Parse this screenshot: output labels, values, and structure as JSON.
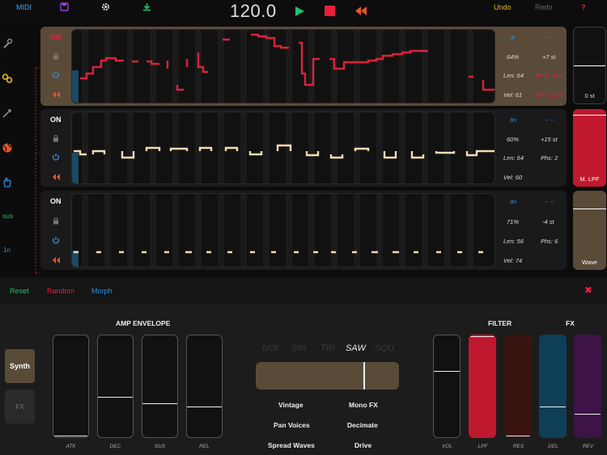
{
  "topbar": {
    "midi": "MIDI",
    "tempo": "120.0",
    "undo": "Undo",
    "redo": "Redo",
    "help": "?",
    "icons": [
      "save-icon",
      "gear-icon",
      "download-icon",
      "play-icon",
      "stop-icon",
      "rewind-icon"
    ]
  },
  "sidebar": {
    "sus_label": "sus",
    "oneN_label": "1n"
  },
  "rows": [
    {
      "on_label": "ON",
      "division": "4t",
      "percent": "64%",
      "transpose": "+7 st",
      "length": "Len: 64",
      "extra": "RPT: 30%",
      "velocity": "Vel: 61",
      "extra2": "RPT: 10%",
      "arrows": "→ ←"
    },
    {
      "on_label": "ON",
      "division": "8n",
      "percent": "60%",
      "transpose": "+15 st",
      "length": "Len: 64",
      "extra": "Phs: 2",
      "velocity": "Vel: 60",
      "arrows": "→ ←"
    },
    {
      "on_label": "ON",
      "division": "8n",
      "percent": "71%",
      "transpose": "-4 st",
      "length": "Len: 56",
      "extra": "Phs: 6",
      "velocity": "Vel: 74",
      "arrows": "→ ←"
    }
  ],
  "macros": [
    {
      "label": "0 st",
      "level": 0.5
    },
    {
      "label": "M. LPF",
      "level": 0.93
    },
    {
      "label": "Wave",
      "level": 0.78
    }
  ],
  "actions": {
    "reset": "Reset",
    "random": "Random",
    "morph": "Morph",
    "close": "✖"
  },
  "bottom": {
    "tab_synth": "Synth",
    "tab_fx": "FX",
    "amp_env": "AMP ENVELOPE",
    "filter": "FILTER",
    "fx": "FX",
    "env_sliders": [
      {
        "label": "ATK",
        "level": 0.0
      },
      {
        "label": "DEC",
        "level": 0.4
      },
      {
        "label": "SUS",
        "level": 0.33
      },
      {
        "label": "REL",
        "level": 0.3
      }
    ],
    "waves": [
      "NOI",
      "SIN",
      "TRI",
      "SAW",
      "SQU"
    ],
    "selected_wave": "SAW",
    "wave_mix": 0.75,
    "options": [
      "Vintage",
      "Mono FX",
      "Pan Voices",
      "Decimate",
      "Spread Waves",
      "Drive"
    ],
    "right_sliders": [
      {
        "label": "VOL",
        "level": 0.65,
        "color": "#111111"
      },
      {
        "label": "LPF",
        "level": 1.0,
        "color": "#c0182e"
      },
      {
        "label": "RES",
        "level": 0.0,
        "color": "#3a1410"
      },
      {
        "label": "DEL",
        "level": 0.3,
        "color": "#0f3e58"
      },
      {
        "label": "REV",
        "level": 0.23,
        "color": "#3e1448"
      }
    ]
  },
  "colors": {
    "red": "#e8203a",
    "cream": "#f2dcb2",
    "blue": "#2e8bd8",
    "green": "#22c06a",
    "purple": "#9b3ee0",
    "orange": "#e8542a"
  }
}
